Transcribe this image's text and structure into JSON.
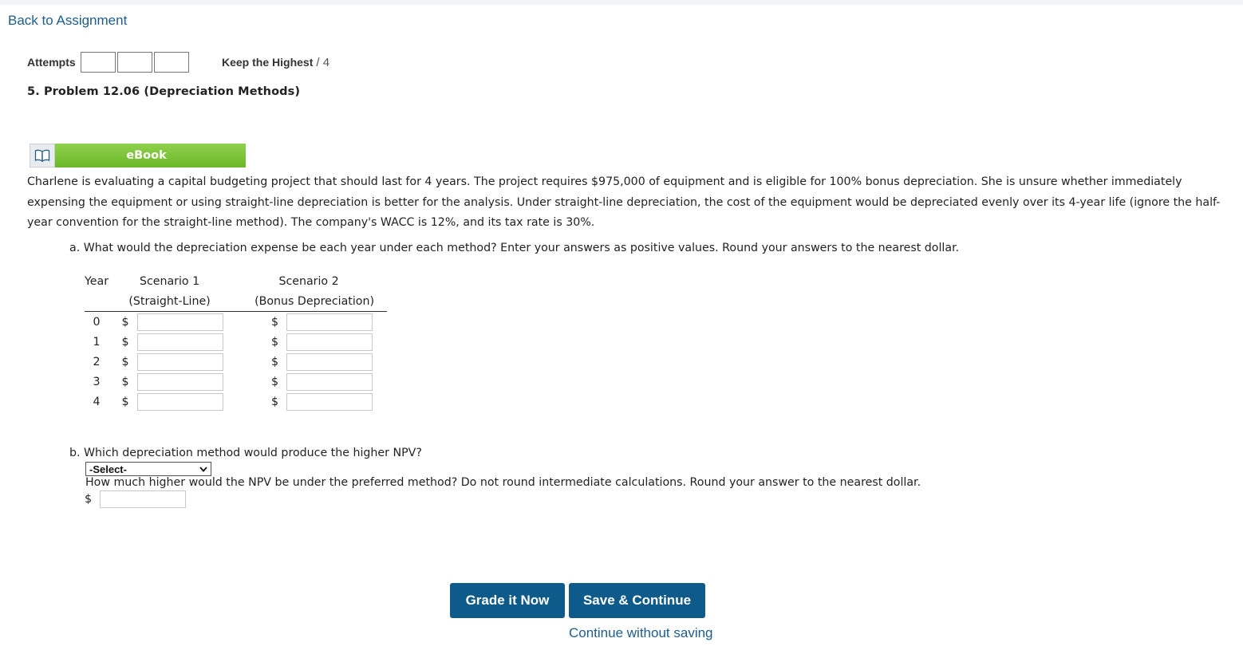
{
  "nav": {
    "back_label": "Back to Assignment"
  },
  "attempts": {
    "label": "Attempts",
    "keep_label": "Keep the Highest",
    "max_text": "/ 4"
  },
  "problem": {
    "title": "5. Problem 12.06 (Depreciation Methods)"
  },
  "ebook": {
    "label": "eBook",
    "icon": "book-icon"
  },
  "prose": "Charlene is evaluating a capital budgeting project that should last for 4 years. The project requires $975,000 of equipment and is eligible for 100% bonus depreciation. She is unsure whether immediately expensing the equipment or using straight-line depreciation is better for the analysis. Under straight-line depreciation, the cost of the equipment would be depreciated evenly over its 4-year life (ignore the half-year convention for the straight-line method). The company's WACC is 12%, and its tax rate is 30%.",
  "part_a": {
    "question": "a. What would the depreciation expense be each year under each method? Enter your answers as positive values. Round your answers to the nearest dollar.",
    "table": {
      "year_header": "Year",
      "col1_title": "Scenario 1",
      "col1_sub": "(Straight-Line)",
      "col2_title": "Scenario 2",
      "col2_sub": "(Bonus Depreciation)",
      "currency": "$",
      "rows": [
        {
          "year": "0",
          "s1": "",
          "s2": ""
        },
        {
          "year": "1",
          "s1": "",
          "s2": ""
        },
        {
          "year": "2",
          "s1": "",
          "s2": ""
        },
        {
          "year": "3",
          "s1": "",
          "s2": ""
        },
        {
          "year": "4",
          "s1": "",
          "s2": ""
        }
      ]
    }
  },
  "part_b": {
    "question": "b. Which depreciation method would produce the higher NPV?",
    "select_value": "-Select-",
    "question2": "How much higher would the NPV be under the preferred method? Do not round intermediate calculations. Round your answer to the nearest dollar.",
    "currency": "$",
    "npv_value": ""
  },
  "buttons": {
    "grade_label": "Grade it Now",
    "save_label": "Save & Continue",
    "continue_label": "Continue without saving"
  },
  "colors": {
    "link": "#1d5c8c",
    "button": "#0e5a8a",
    "ebook_green": "#76c043"
  }
}
